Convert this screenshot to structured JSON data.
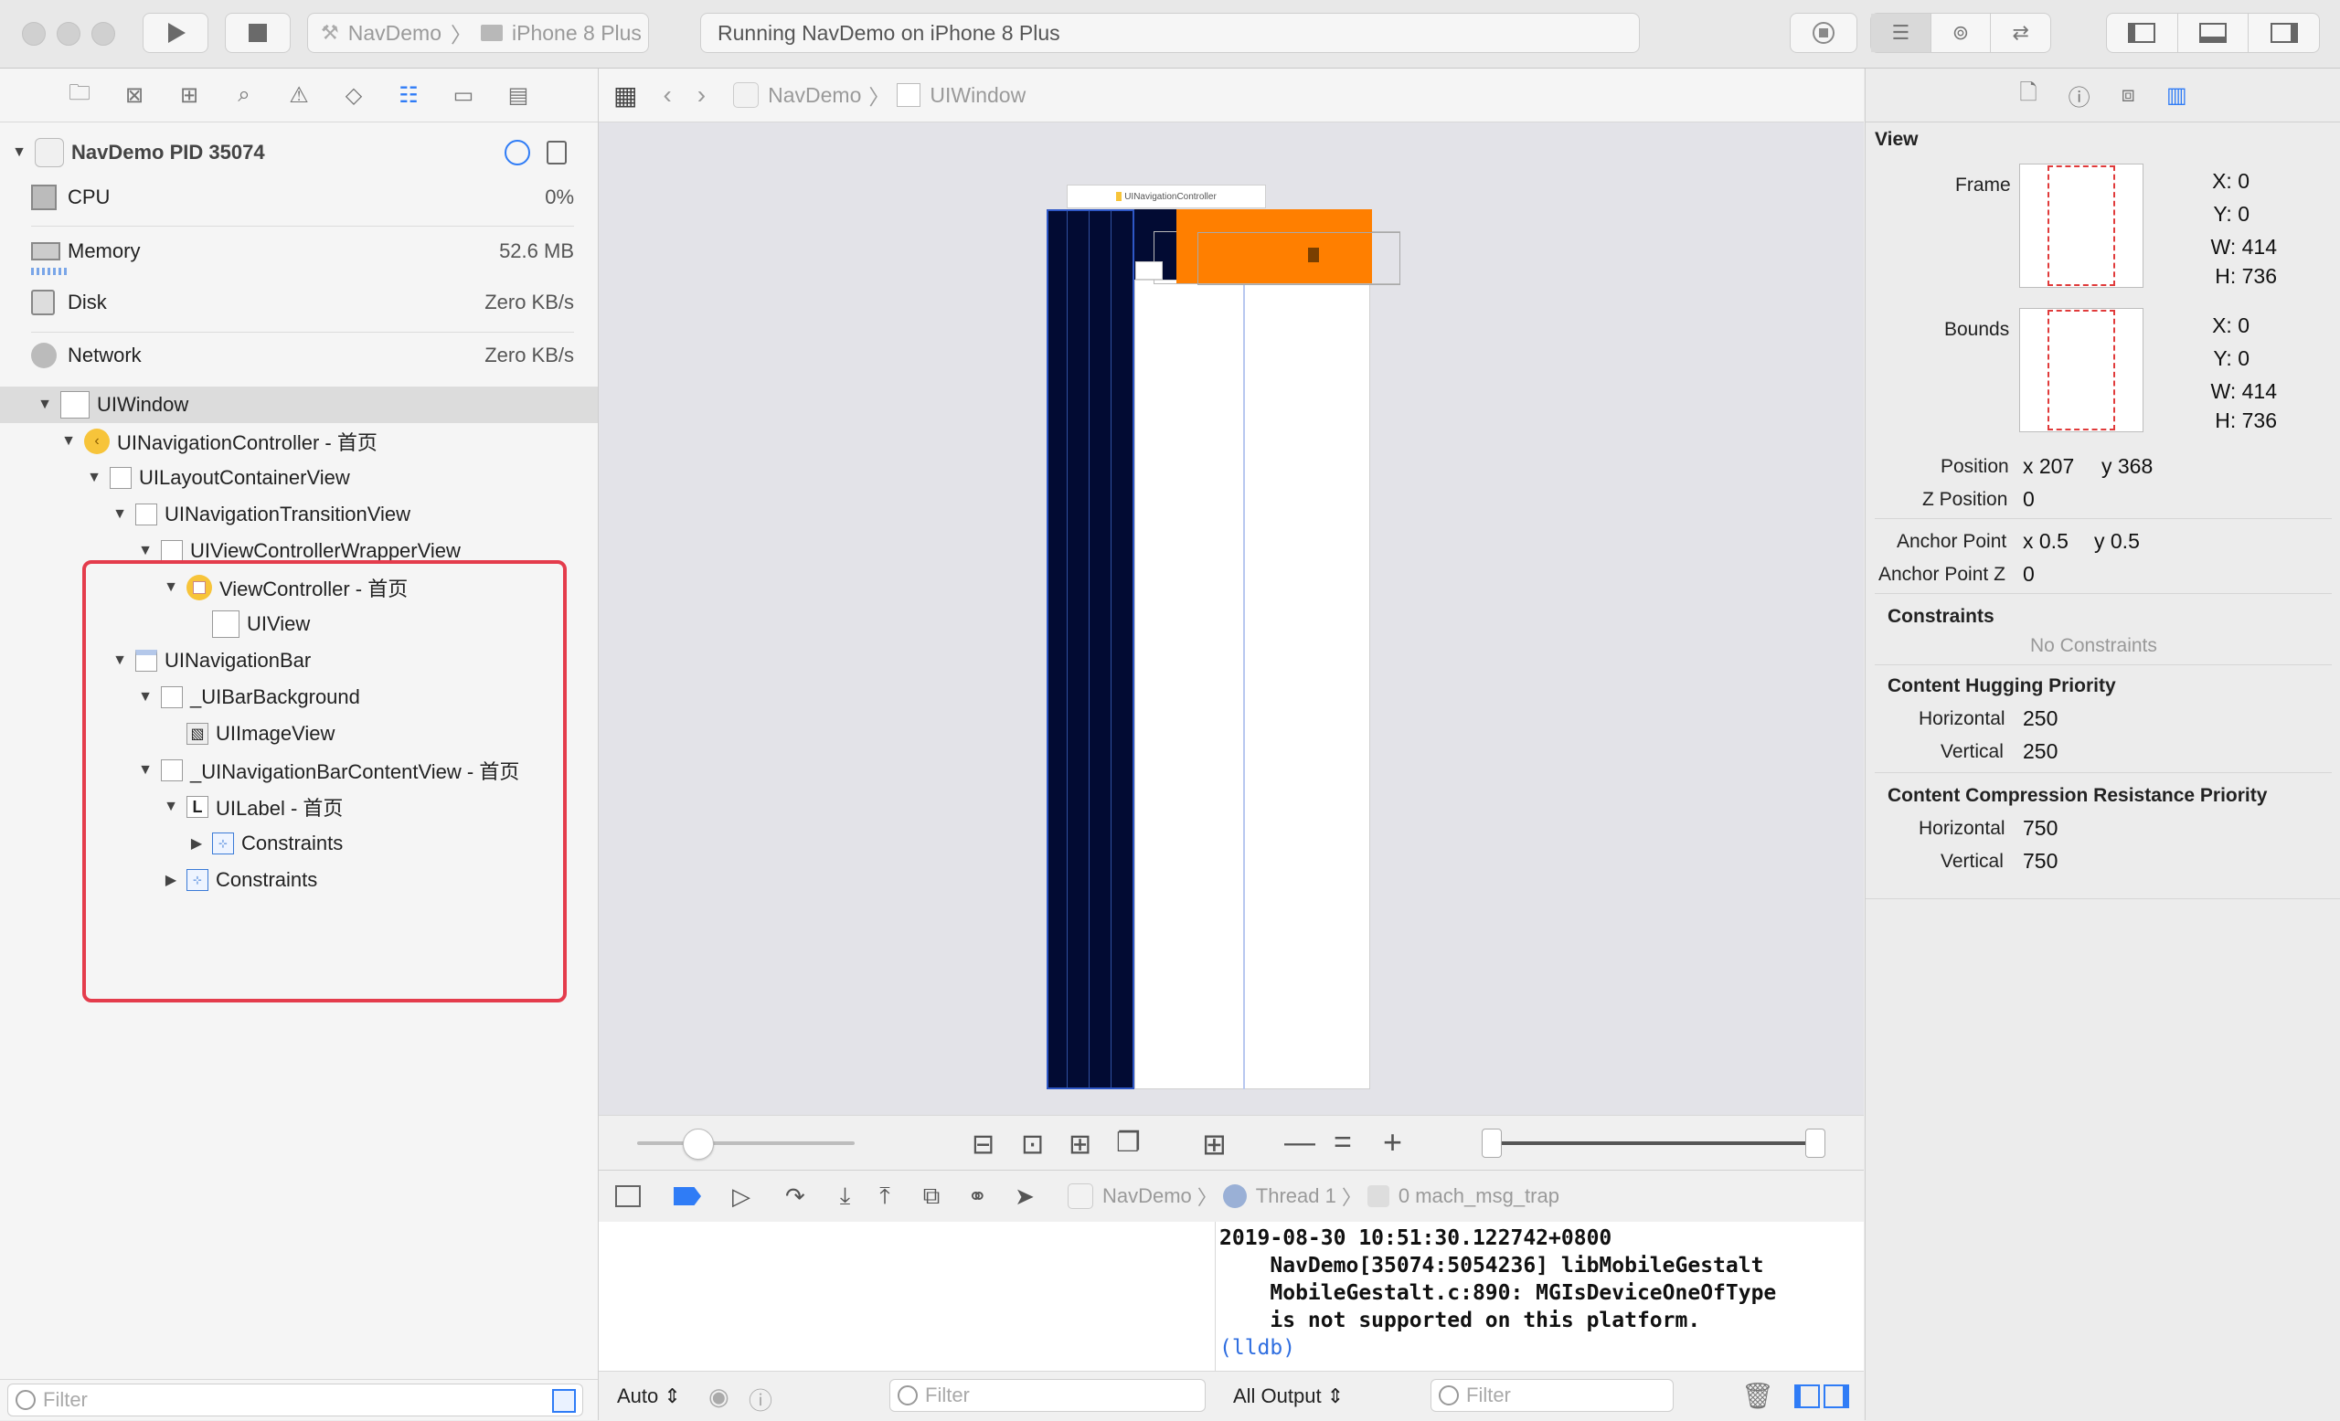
{
  "toolbar": {
    "scheme_app": "NavDemo",
    "scheme_device": "iPhone 8 Plus",
    "status_text": "Running NavDemo on iPhone 8 Plus"
  },
  "process": {
    "name": "NavDemo PID 35074",
    "gauges": [
      {
        "label": "CPU",
        "value": "0%"
      },
      {
        "label": "Memory",
        "value": "52.6 MB"
      },
      {
        "label": "Disk",
        "value": "Zero KB/s"
      },
      {
        "label": "Network",
        "value": "Zero KB/s"
      }
    ]
  },
  "tree": [
    {
      "label": "UIWindow"
    },
    {
      "label": "UINavigationController - 首页"
    },
    {
      "label": "UILayoutContainerView"
    },
    {
      "label": "UINavigationTransitionView"
    },
    {
      "label": "UIViewControllerWrapperView"
    },
    {
      "label": "ViewController - 首页"
    },
    {
      "label": "UIView"
    },
    {
      "label": "UINavigationBar"
    },
    {
      "label": "_UIBarBackground"
    },
    {
      "label": "UIImageView"
    },
    {
      "label": "_UINavigationBarContentView - 首页"
    },
    {
      "label": "UILabel - 首页"
    },
    {
      "label": "Constraints"
    },
    {
      "label": "Constraints"
    }
  ],
  "left_filter_placeholder": "Filter",
  "jumpbar": {
    "app": "NavDemo",
    "object": "UIWindow"
  },
  "canvas": {
    "nav_label": "UINavigationController"
  },
  "debugbar": {
    "app": "NavDemo",
    "thread": "Thread 1",
    "frame": "0 mach_msg_trap"
  },
  "bottom": {
    "auto_label": "Auto",
    "var_filter": "Filter",
    "output_label": "All Output",
    "console_filter": "Filter"
  },
  "console_lines": [
    "2019-08-30 10:51:30.122742+0800",
    "    NavDemo[35074:5054236] libMobileGestalt",
    "    MobileGestalt.c:890: MGIsDeviceOneOfType",
    "    is not supported on this platform."
  ],
  "console_prompt": "(lldb)",
  "inspector": {
    "section": "View",
    "frame_label": "Frame",
    "frame": {
      "x": "X: 0",
      "y": "Y: 0",
      "w": "W: 414",
      "h": "H: 736"
    },
    "bounds_label": "Bounds",
    "bounds": {
      "x": "X: 0",
      "y": "Y: 0",
      "w": "W: 414",
      "h": "H: 736"
    },
    "position_label": "Position",
    "position_x": "x 207",
    "position_y": "y 368",
    "zpos_label": "Z Position",
    "zpos": "0",
    "anchor_label": "Anchor Point",
    "anchor_x": "x 0.5",
    "anchor_y": "y 0.5",
    "anchorz_label": "Anchor Point Z",
    "anchorz": "0",
    "constraints_title": "Constraints",
    "no_constraints": "No Constraints",
    "hugging_title": "Content Hugging Priority",
    "hug_h_label": "Horizontal",
    "hug_h": "250",
    "hug_v_label": "Vertical",
    "hug_v": "250",
    "compression_title": "Content Compression Resistance Priority",
    "comp_h_label": "Horizontal",
    "comp_h": "750",
    "comp_v_label": "Vertical",
    "comp_v": "750"
  },
  "colors": {
    "accent": "#2f7cf6",
    "orange": "#ff7f00",
    "navy": "#020b33",
    "highlight": "#e43c4c"
  }
}
